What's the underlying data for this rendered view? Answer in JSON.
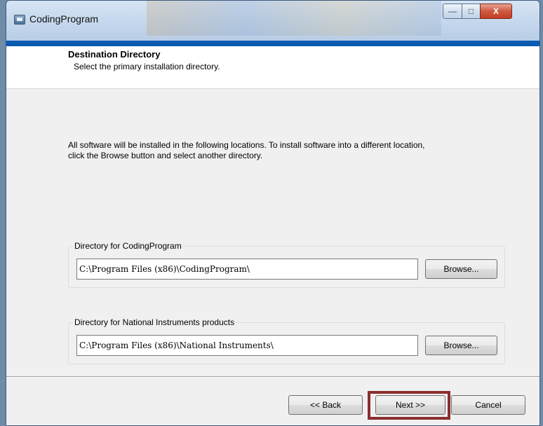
{
  "window": {
    "title": "CodingProgram",
    "icons": {
      "app": "installer-icon",
      "minimize": "minimize-icon",
      "maximize": "maximize-icon",
      "close": "close-icon"
    },
    "controls": {
      "minimize": "—",
      "maximize": "□",
      "close": "X"
    }
  },
  "header": {
    "title": "Destination Directory",
    "subtitle": "Select the primary installation directory."
  },
  "description": "All software will be installed in the following locations. To install software into a different location, click the Browse button and select another directory.",
  "groups": [
    {
      "label": "Directory for CodingProgram",
      "path": "C:\\Program Files (x86)\\CodingProgram\\",
      "button": "Browse..."
    },
    {
      "label": "Directory for National Instruments products",
      "path": "C:\\Program Files (x86)\\National Instruments\\",
      "button": "Browse..."
    }
  ],
  "footer": {
    "back": "<< Back",
    "next": "Next >>",
    "cancel": "Cancel"
  },
  "colors": {
    "accent_bar": "#0a5bb2",
    "highlight": "#8b2e2e"
  }
}
